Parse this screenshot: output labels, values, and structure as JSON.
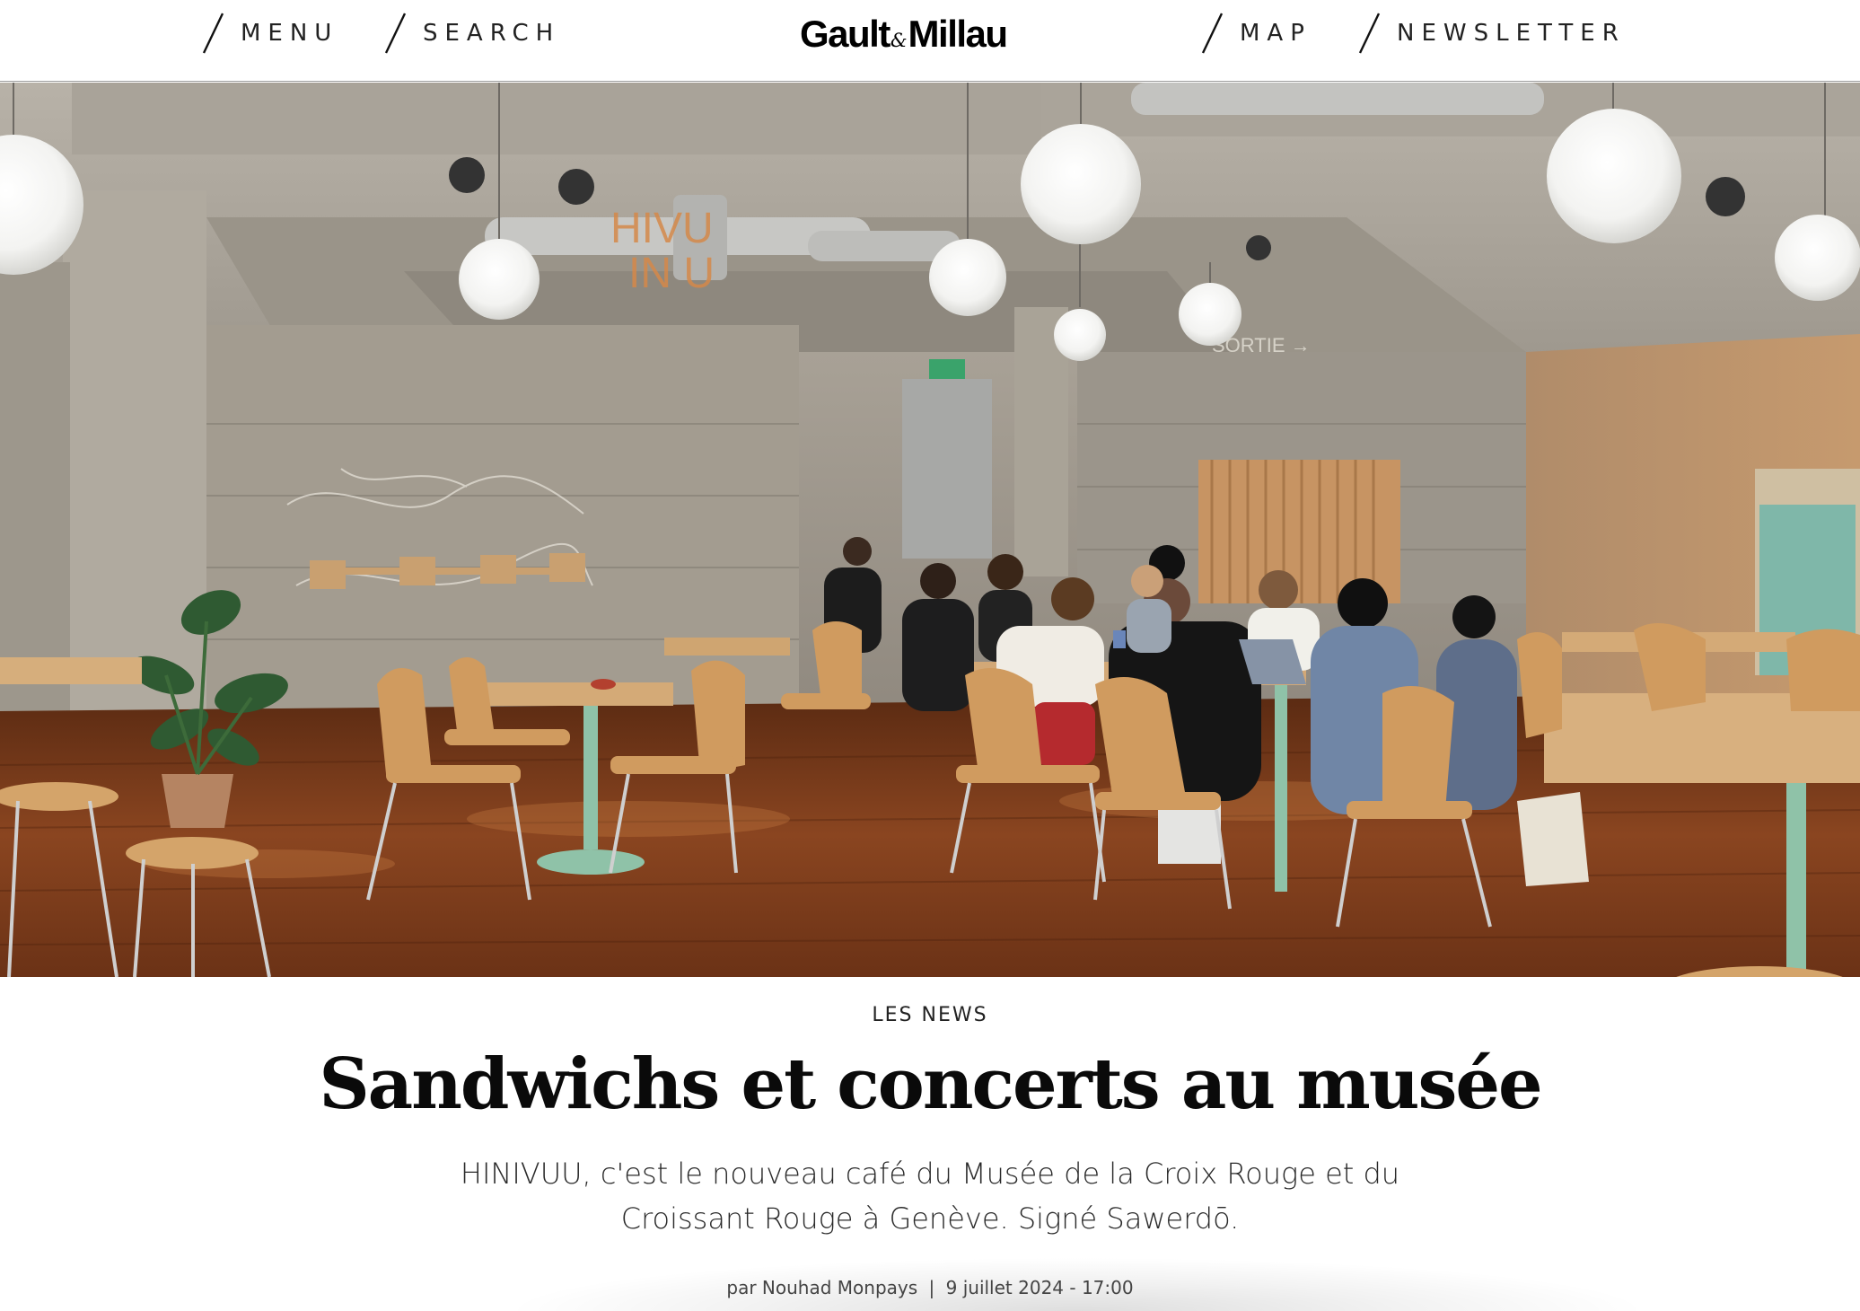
{
  "header": {
    "nav_left": [
      {
        "label": "MENU"
      },
      {
        "label": "SEARCH"
      }
    ],
    "logo": {
      "part1": "Gault",
      "amp": "&",
      "part2": "Millau"
    },
    "nav_right": [
      {
        "label": "MAP"
      },
      {
        "label": "NEWSLETTER"
      }
    ]
  },
  "hero": {
    "wall_sign": "SORTIE →"
  },
  "article": {
    "category": "LES NEWS",
    "title": "Sandwichs et concerts au musée",
    "lede": "HINIVUU, c'est le nouveau café du Musée de la Croix Rouge et du Croissant Rouge à Genève. Signé Sawerdō.",
    "author": "par Nouhad Monpays",
    "separator": "|",
    "date": "9 juillet 2024 - 17:00"
  },
  "colors": {
    "text": "#111111",
    "header_border": "#9a9a9a",
    "concrete": "#9e978e",
    "wood_floor": "#7a3a18",
    "mint_legs": "#8fc2a8"
  }
}
